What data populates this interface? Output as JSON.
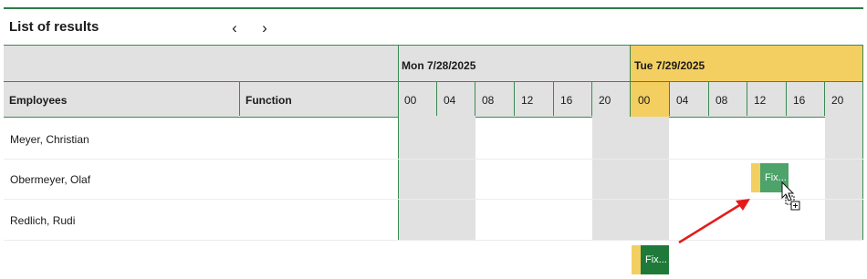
{
  "header": {
    "title": "List of results",
    "prev_icon": "‹",
    "next_icon": "›"
  },
  "columns": {
    "employees": "Employees",
    "function": "Function"
  },
  "days": [
    {
      "label": "Mon 7/28/2025",
      "highlighted": false,
      "hours": [
        "00",
        "04",
        "08",
        "12",
        "16",
        "20"
      ]
    },
    {
      "label": "Tue 7/29/2025",
      "highlighted": true,
      "hours": [
        "00",
        "04",
        "08",
        "12",
        "16",
        "20"
      ]
    }
  ],
  "rows": [
    {
      "employee": "Meyer, Christian"
    },
    {
      "employee": "Obermeyer, Olaf"
    },
    {
      "employee": "Redlich, Rudi"
    }
  ],
  "shifts": {
    "dragged": {
      "label": "Fix..."
    },
    "original": {
      "label": "Fix..."
    }
  },
  "colors": {
    "accent_green": "#2e7d4a",
    "shift_green": "#4da36a",
    "shift_green_dark": "#1f7a3a",
    "highlight_yellow": "#f3cf62",
    "arrow_red": "#e31b1b"
  }
}
